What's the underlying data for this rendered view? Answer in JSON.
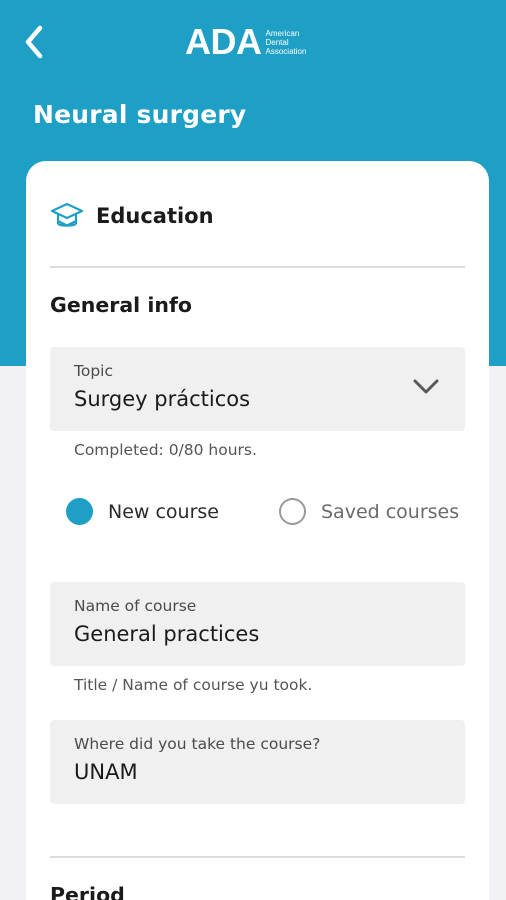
{
  "header": {
    "back_icon": "chevron-left-icon",
    "logo": {
      "mark": "ADA",
      "subtitle_lines": [
        "American",
        "Dental",
        "Association"
      ]
    },
    "title": "Neural surgery"
  },
  "card": {
    "section_icon": "graduation-cap-icon",
    "section_title": "Education",
    "general_info_title": "General info",
    "topic": {
      "label": "Topic",
      "value": "Surgey prácticos",
      "helper": "Completed: 0/80 hours.",
      "dropdown_icon": "chevron-down-icon"
    },
    "course_type": {
      "options": [
        {
          "label": "New course",
          "selected": true
        },
        {
          "label": "Saved courses",
          "selected": false
        }
      ]
    },
    "course_name": {
      "label": "Name of course",
      "value": "General practices",
      "helper": "Title / Name of course yu took."
    },
    "course_place": {
      "label": "Where did you take the course?",
      "value": "UNAM"
    },
    "period_title": "Period"
  },
  "colors": {
    "primary": "#1e9fc6",
    "background": "#f2f1f3",
    "field_bg": "#f1f0f1",
    "card_bg": "#ffffff",
    "text_dark": "#1b1b1b"
  }
}
